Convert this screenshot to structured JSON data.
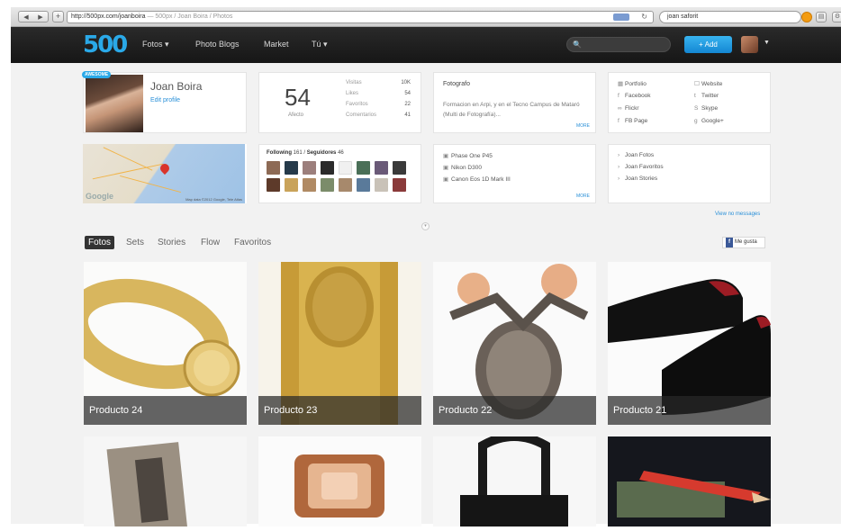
{
  "browser": {
    "url_main": "http://500px.com/joanboira",
    "url_dim": " — 500px / Joan Boira / Photos",
    "search_value": "joan saforit",
    "nav_back": "◀",
    "nav_forward": "▶",
    "plus": "+"
  },
  "header": {
    "logo": "500",
    "nav": [
      "Fotos ▾",
      "Photo Blogs",
      "Market",
      "Tú ▾"
    ],
    "search_placeholder": "🔍",
    "add_label": "+   Add"
  },
  "profile": {
    "badge": "AWESOME",
    "name": "Joan Boira",
    "edit_link": "Edit profile"
  },
  "stats": {
    "big_number": "54",
    "big_label": "Afecto",
    "rows": [
      {
        "label": "Visitas",
        "value": "10K"
      },
      {
        "label": "Likes",
        "value": "54"
      },
      {
        "label": "Favoritos",
        "value": "22"
      },
      {
        "label": "Comentarios",
        "value": "41"
      }
    ]
  },
  "about": {
    "title": "Fotografo",
    "text": "Formacion en Arpi, y en el Tecno Campus de Mataró (Multi de Fotografía)...",
    "more": "MORE"
  },
  "links": [
    {
      "icon": "▦",
      "label": "Portfolio"
    },
    {
      "icon": "☐",
      "label": "Website"
    },
    {
      "icon": "f",
      "label": "Facebook"
    },
    {
      "icon": "t",
      "label": "Twitter"
    },
    {
      "icon": "∞",
      "label": "Flickr"
    },
    {
      "icon": "S",
      "label": "Skype"
    },
    {
      "icon": "f",
      "label": "FB Page"
    },
    {
      "icon": "g",
      "label": "Google+"
    }
  ],
  "map": {
    "brand": "Google",
    "credit": "Map data ©2012 Google, Tele Atlas"
  },
  "following": {
    "title_a": "Following",
    "count_a": "161",
    "title_b": "Seguidores",
    "count_b": "46"
  },
  "cameras": {
    "items": [
      "Phase One P45",
      "Nikon D300",
      "Canon Eos 1D Mark III"
    ],
    "more": "MORE"
  },
  "galleries": [
    "Joan Fotos",
    "Joan Favoritos",
    "Joan Stories"
  ],
  "view_messages": "View no messages",
  "tabs": [
    "Fotos",
    "Sets",
    "Stories",
    "Flow",
    "Favoritos"
  ],
  "fb_button": "Me gusta",
  "photos": [
    {
      "caption": "Producto 24"
    },
    {
      "caption": "Producto 23"
    },
    {
      "caption": "Producto 22"
    },
    {
      "caption": "Producto 21"
    }
  ],
  "colors": {
    "accent": "#2aa9e8",
    "topbar": "#1c1c1c"
  }
}
